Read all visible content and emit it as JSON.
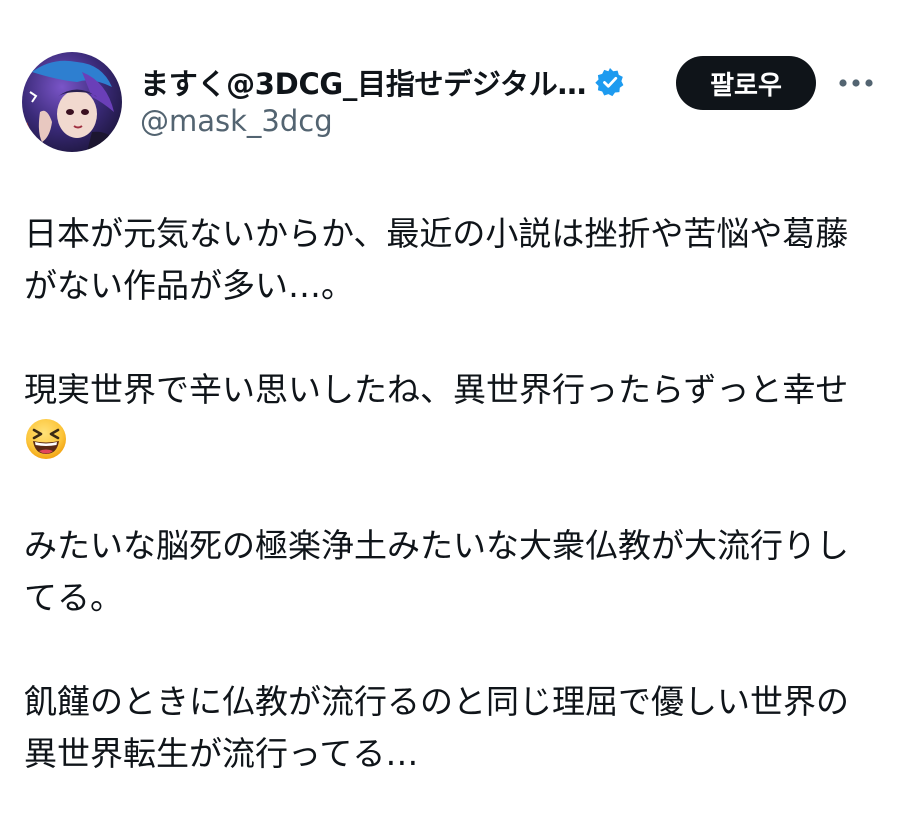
{
  "user": {
    "display_name": "ますく@3DCG_目指せデジタル…",
    "handle": "@mask_3dcg",
    "verified": true,
    "verified_color": "#1d9bf0"
  },
  "actions": {
    "follow_label": "팔로우",
    "more_icon": "more-horizontal-icon"
  },
  "tweet": {
    "paragraphs": [
      {
        "lines": [
          "日本が元気ないからか、最近の小説は挫折や苦悩や葛藤",
          "がない作品が多い…。"
        ]
      },
      {
        "lines": [
          "現実世界で辛い思いしたね、異世界行ったらずっと幸せ"
        ],
        "emoji": "grinning-squinting-face-emoji"
      },
      {
        "lines": [
          "みたいな脳死の極楽浄土みたいな大衆仏教が大流行りし",
          "てる。"
        ]
      },
      {
        "lines": [
          "飢饉のときに仏教が流行るのと同じ理屈で優しい世界の",
          "異世界転生が流行ってる…"
        ]
      }
    ]
  }
}
